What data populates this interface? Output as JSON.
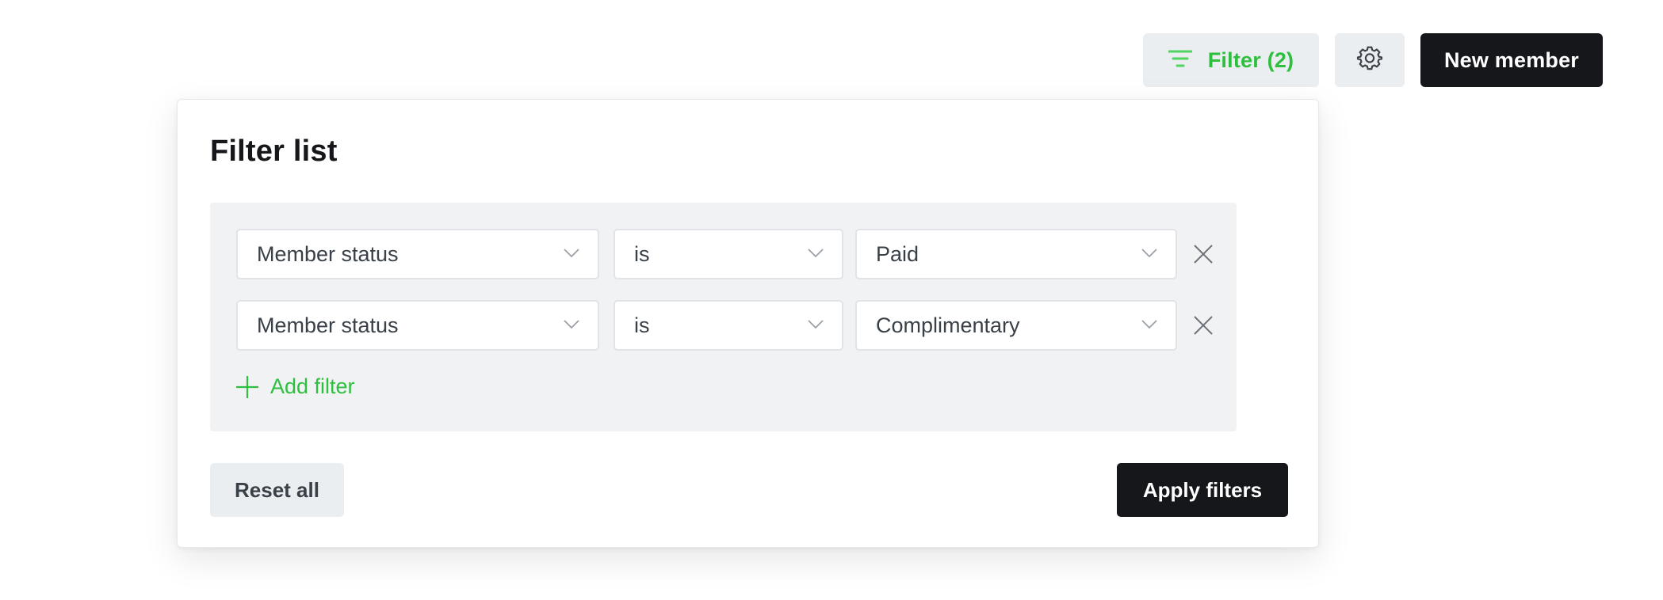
{
  "toolbar": {
    "filter_label": "Filter (2)",
    "filter_icon": "filter-lines-icon",
    "settings_icon": "gear-icon",
    "new_member_label": "New member"
  },
  "panel": {
    "title": "Filter list",
    "filters": [
      {
        "field": "Member status",
        "operator": "is",
        "value": "Paid"
      },
      {
        "field": "Member status",
        "operator": "is",
        "value": "Complimentary"
      }
    ],
    "add_filter_label": "Add filter",
    "reset_label": "Reset all",
    "apply_label": "Apply filters"
  },
  "colors": {
    "accent_green": "#30cf43",
    "dark_button": "#15171a",
    "light_button": "#ebeef0",
    "filter_box_bg": "#f1f2f4"
  }
}
